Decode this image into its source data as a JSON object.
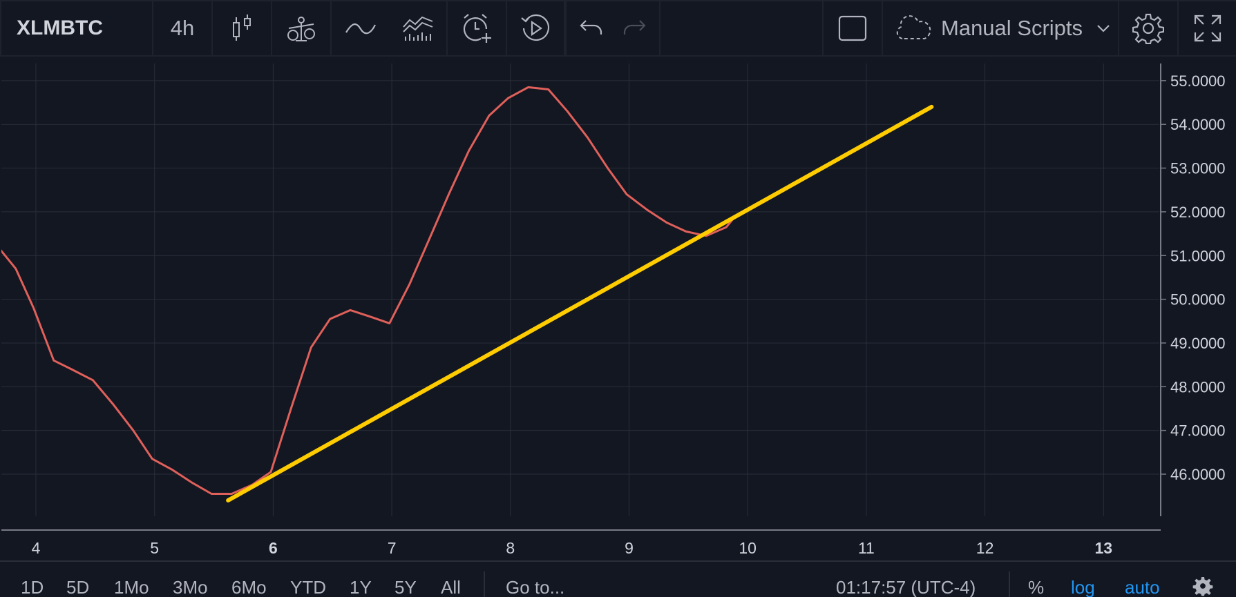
{
  "toolbar": {
    "symbol": "XLMBTC",
    "interval": "4h",
    "manual_scripts": "Manual Scripts"
  },
  "icons": {
    "chart_type": "candlestick-icon",
    "compare": "compare-icon",
    "indicators": "indicator-wave-icon",
    "financials": "financials-icon",
    "alert": "alarm-clock-icon",
    "replay": "replay-icon",
    "undo": "undo-icon",
    "redo": "redo-icon",
    "layout": "square-icon",
    "cloud": "cloud-icon",
    "settings": "gear-icon",
    "fullscreen": "fullscreen-icon"
  },
  "colors": {
    "background": "#131722",
    "panel": "#1e222d",
    "grid": "#2a2e39",
    "price_line": "#e0605a",
    "trend_line": "#ffcc00",
    "accent": "#2196f3"
  },
  "chart_data": {
    "type": "line",
    "x_ticks": [
      "4",
      "5",
      "6",
      "7",
      "8",
      "9",
      "10",
      "11",
      "12",
      "13"
    ],
    "x_ticks_bold": [
      "6",
      "13"
    ],
    "y_ticks": [
      "46.0000",
      "47.0000",
      "48.0000",
      "49.0000",
      "50.0000",
      "51.0000",
      "52.0000",
      "53.0000",
      "54.0000",
      "55.0000"
    ],
    "xlim": [
      3.7,
      13.45
    ],
    "ylim": [
      44.95,
      55.5
    ],
    "grid": true,
    "series": [
      {
        "values": [
          [
            3.68,
            51.2
          ],
          [
            3.83,
            50.7
          ],
          [
            3.98,
            49.8
          ],
          [
            4.15,
            48.6
          ],
          [
            4.3,
            48.4
          ],
          [
            4.48,
            48.15
          ],
          [
            4.65,
            47.6
          ],
          [
            4.82,
            47.0
          ],
          [
            4.98,
            46.35
          ],
          [
            5.15,
            46.1
          ],
          [
            5.32,
            45.8
          ],
          [
            5.48,
            45.55
          ],
          [
            5.65,
            45.55
          ],
          [
            5.82,
            45.75
          ],
          [
            5.98,
            46.05
          ],
          [
            6.15,
            47.5
          ],
          [
            6.32,
            48.9
          ],
          [
            6.48,
            49.55
          ],
          [
            6.65,
            49.75
          ],
          [
            6.82,
            49.6
          ],
          [
            6.98,
            49.45
          ],
          [
            7.15,
            50.35
          ],
          [
            7.32,
            51.4
          ],
          [
            7.48,
            52.4
          ],
          [
            7.65,
            53.4
          ],
          [
            7.82,
            54.2
          ],
          [
            7.98,
            54.6
          ],
          [
            8.15,
            54.85
          ],
          [
            8.32,
            54.8
          ],
          [
            8.48,
            54.3
          ],
          [
            8.65,
            53.7
          ],
          [
            8.82,
            53.0
          ],
          [
            8.98,
            52.4
          ],
          [
            9.15,
            52.05
          ],
          [
            9.32,
            51.75
          ],
          [
            9.48,
            51.55
          ],
          [
            9.65,
            51.45
          ],
          [
            9.82,
            51.65
          ],
          [
            9.88,
            51.85
          ]
        ]
      }
    ],
    "trend_line": {
      "x1": 5.62,
      "y1": 45.4,
      "x2": 11.55,
      "y2": 54.4
    }
  },
  "bottom_bar": {
    "ranges": [
      "1D",
      "5D",
      "1Mo",
      "3Mo",
      "6Mo",
      "YTD",
      "1Y",
      "5Y",
      "All"
    ],
    "goto": "Go to...",
    "time": "01:17:57 (UTC-4)",
    "percent": "%",
    "log": "log",
    "auto": "auto"
  }
}
